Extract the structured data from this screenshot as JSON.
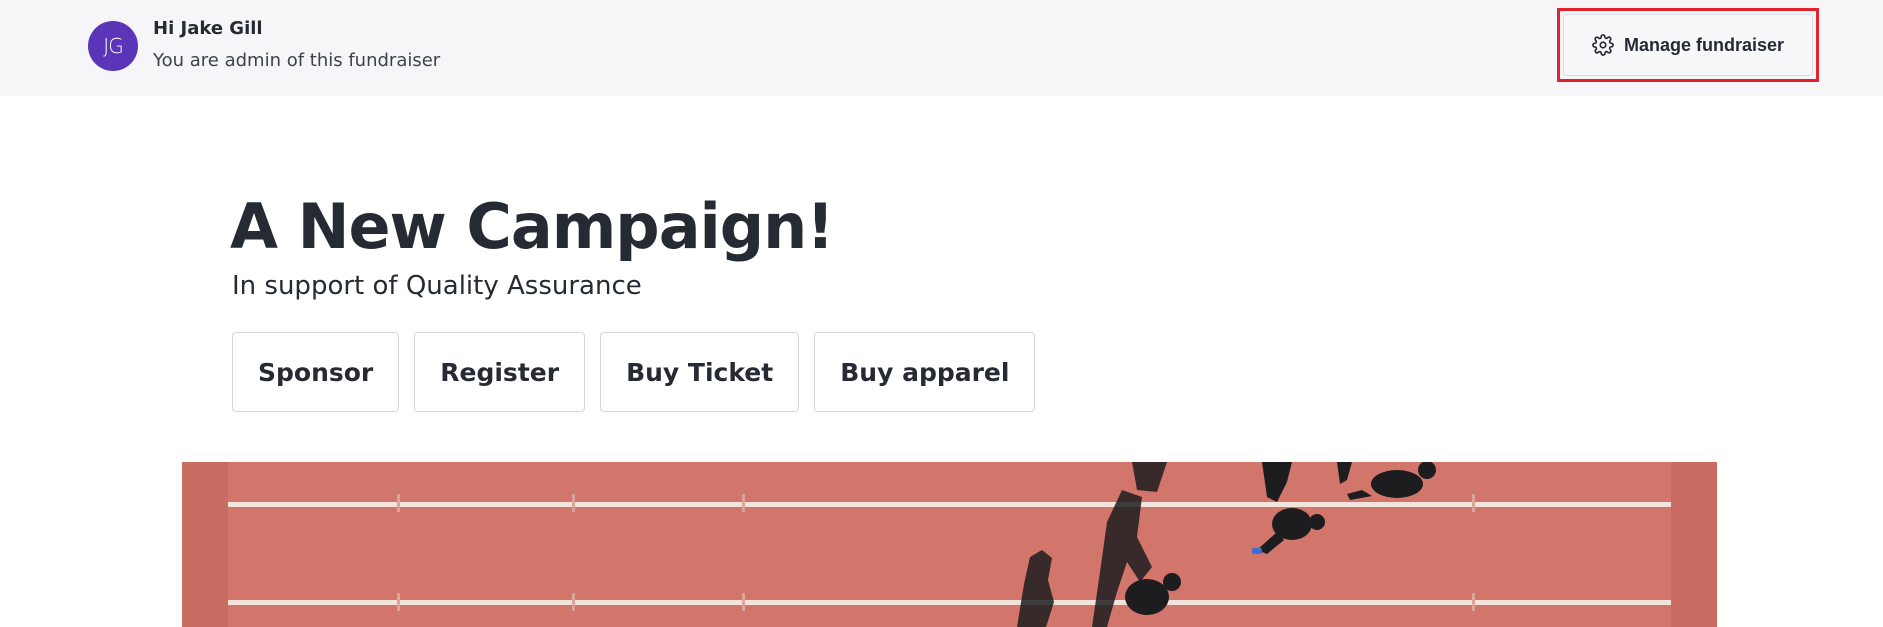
{
  "admin_bar": {
    "avatar_initials": "JG",
    "greeting": "Hi Jake Gill",
    "role_note": "You are admin of this fundraiser",
    "manage_button": {
      "label": "Manage fundraiser",
      "icon": "gear-icon"
    }
  },
  "campaign": {
    "title": "A New Campaign!",
    "subtitle": "In support of Quality Assurance",
    "actions": [
      {
        "label": "Sponsor"
      },
      {
        "label": "Register"
      },
      {
        "label": "Buy Ticket"
      },
      {
        "label": "Buy apparel"
      }
    ]
  },
  "colors": {
    "avatar": "#5b35b8",
    "highlight": "#e0232c",
    "track": "#d2766b"
  }
}
